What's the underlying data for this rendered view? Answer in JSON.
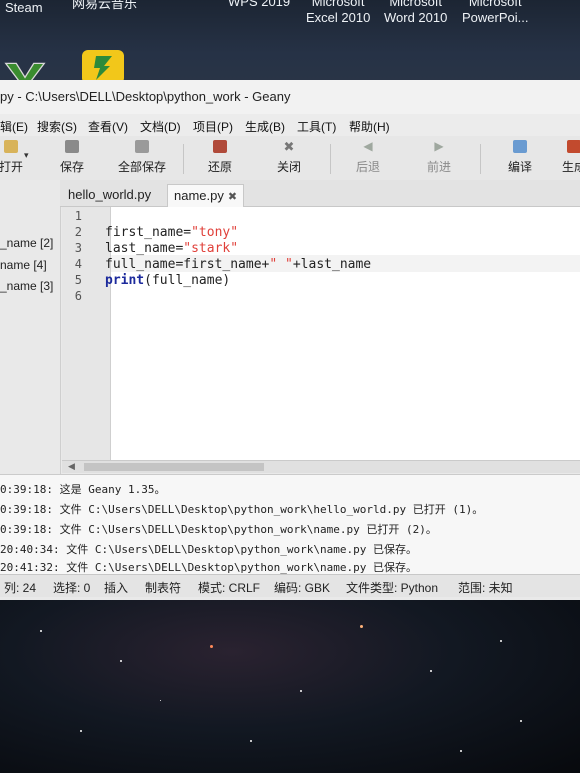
{
  "desktop": {
    "icons": [
      {
        "label": "Steam"
      },
      {
        "label": "网易云音乐"
      },
      {
        "label": "WPS 2019"
      },
      {
        "label_line1": "Microsoft",
        "label_line2": "Excel 2010"
      },
      {
        "label_line1": "Microsoft",
        "label_line2": "Word 2010"
      },
      {
        "label_line1": "Microsoft",
        "label_line2": "PowerPoi..."
      }
    ]
  },
  "window": {
    "title": "py - C:\\Users\\DELL\\Desktop\\python_work - Geany"
  },
  "menu": [
    "辑(E)",
    "搜索(S)",
    "查看(V)",
    "文档(D)",
    "项目(P)",
    "生成(B)",
    "工具(T)",
    "帮助(H)"
  ],
  "toolbar": {
    "open": "打开",
    "save": "保存",
    "save_all": "全部保存",
    "revert": "还原",
    "close": "关闭",
    "back": "后退",
    "forward": "前进",
    "compile": "编译",
    "build": "生成"
  },
  "sidebar": {
    "items": [
      "_name [2]",
      "name [4]",
      "_name [3]"
    ]
  },
  "tabs": [
    {
      "label": "hello_world.py",
      "close": "✖"
    },
    {
      "label": "name.py",
      "close": "✖"
    }
  ],
  "editor": {
    "line_numbers": [
      "1",
      "2",
      "3",
      "4",
      "5",
      "6"
    ],
    "lines": [
      {
        "plain": "",
        "str": "",
        "tail": ""
      },
      {
        "plain": "first_name=",
        "str": "\"tony\"",
        "tail": ""
      },
      {
        "plain": "last_name=",
        "str": "\"stark\"",
        "tail": ""
      },
      {
        "plain": "full_name=first_name+",
        "str": "\" \"",
        "tail": "+last_name"
      },
      {
        "kw": "print",
        "plain": "(full_name)"
      },
      {
        "plain": ""
      }
    ]
  },
  "messages": [
    "0:39:18: 这是 Geany 1.35。",
    "0:39:18: 文件 C:\\Users\\DELL\\Desktop\\python_work\\hello_world.py 已打开 (1)。",
    "0:39:18: 文件 C:\\Users\\DELL\\Desktop\\python_work\\name.py 已打开 (2)。",
    "20:40:34: 文件 C:\\Users\\DELL\\Desktop\\python_work\\name.py 已保存。",
    "20:41:32: 文件 C:\\Users\\DELL\\Desktop\\python_work\\name.py 已保存。"
  ],
  "status": {
    "col": "列: 24",
    "sel": "选择: 0",
    "ins": "插入",
    "tab": "制表符",
    "mode": "模式: CRLF",
    "enc": "编码: GBK",
    "ftype": "文件类型: Python",
    "scope": "范围: 未知"
  }
}
